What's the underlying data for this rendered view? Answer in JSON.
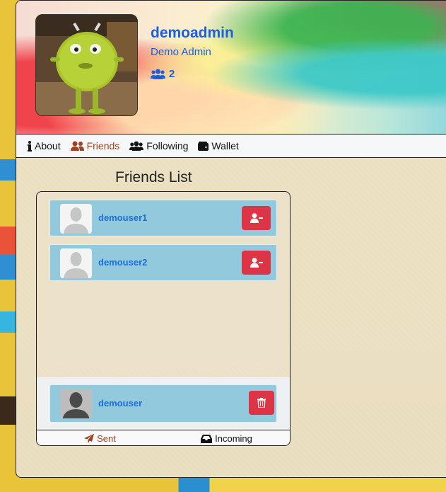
{
  "profile": {
    "name": "demoadmin",
    "username": "Demo Admin",
    "friend_count": "2",
    "avatar_icon": "monster-avatar-icon"
  },
  "nav": {
    "items": [
      {
        "label": "About",
        "icon": "info-icon",
        "active": false
      },
      {
        "label": "Friends",
        "icon": "user-friends-icon",
        "active": true
      },
      {
        "label": "Following",
        "icon": "users-icon",
        "active": false
      },
      {
        "label": "Wallet",
        "icon": "wallet-icon",
        "active": false
      }
    ]
  },
  "friends_list": {
    "title": "Friends List",
    "friends": [
      {
        "name": "demouser1",
        "action_icon": "user-minus-icon"
      },
      {
        "name": "demouser2",
        "action_icon": "user-minus-icon"
      }
    ],
    "sent_requests": [
      {
        "name": "demouser",
        "action_icon": "trash-icon"
      }
    ],
    "tabs": [
      {
        "label": "Sent",
        "icon": "paper-plane-icon",
        "active": true
      },
      {
        "label": "Incoming",
        "icon": "inbox-icon",
        "active": false
      }
    ]
  },
  "colors": {
    "accent_blue": "#1a5fe0",
    "active_nav": "#a0421f",
    "danger": "#dc3545",
    "row_bg": "#93c9dd"
  }
}
